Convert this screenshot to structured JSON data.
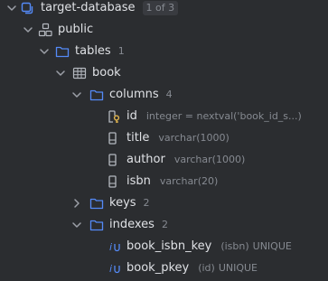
{
  "colors": {
    "background": "#2b2d30",
    "text": "#dfe1e5",
    "muted": "#868a91",
    "accent_blue": "#548af7",
    "key_yellow": "#e0b44e",
    "chevron": "#9da0a8"
  },
  "tree": {
    "datasource": {
      "label": "target-database",
      "badge": "1 of 3",
      "icon": "datasource-icon"
    },
    "schema": {
      "label": "public",
      "icon": "schema-icon"
    },
    "tables_folder": {
      "label": "tables",
      "count": "1"
    },
    "table": {
      "label": "book",
      "icon": "table-icon"
    },
    "columns_folder": {
      "label": "columns",
      "count": "4"
    },
    "columns": [
      {
        "name": "id",
        "type": "integer = nextval('book_id_s...)",
        "icon": "primary-key-column-icon"
      },
      {
        "name": "title",
        "type": "varchar(1000)",
        "icon": "column-icon"
      },
      {
        "name": "author",
        "type": "varchar(1000)",
        "icon": "column-icon"
      },
      {
        "name": "isbn",
        "type": "varchar(20)",
        "icon": "column-icon"
      }
    ],
    "keys_folder": {
      "label": "keys",
      "count": "2"
    },
    "indexes_folder": {
      "label": "indexes",
      "count": "2"
    },
    "indexes": [
      {
        "name": "book_isbn_key",
        "cols": "(isbn)",
        "kind": "UNIQUE",
        "icon": "unique-index-icon"
      },
      {
        "name": "book_pkey",
        "cols": "(id)",
        "kind": "UNIQUE",
        "icon": "unique-index-icon"
      }
    ]
  }
}
